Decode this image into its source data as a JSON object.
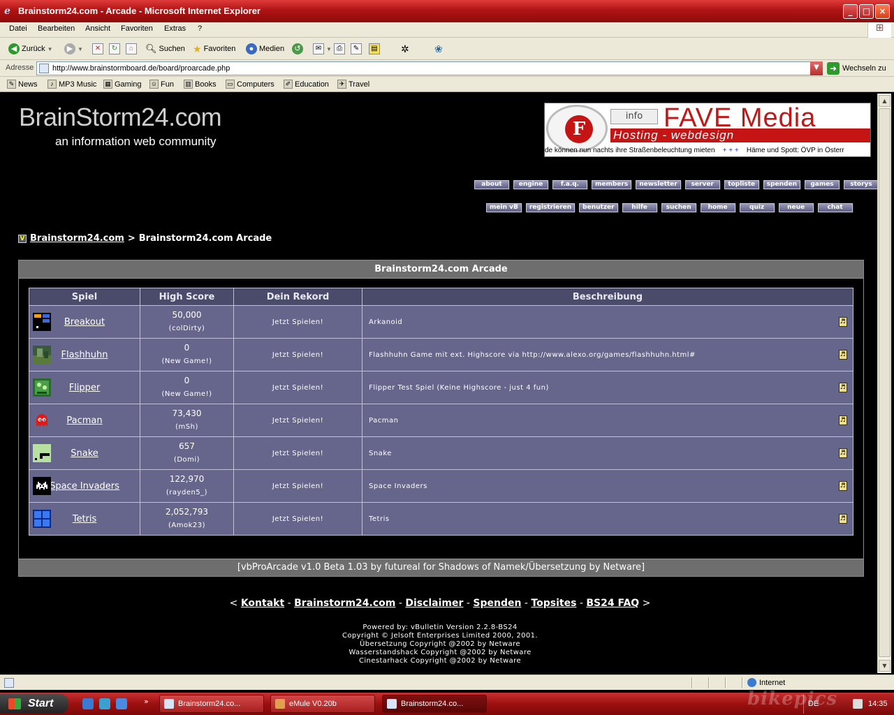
{
  "window": {
    "title": "Brainstorm24.com - Arcade - Microsoft Internet Explorer",
    "controls": [
      "_",
      "□",
      "×"
    ]
  },
  "menubar": [
    "Datei",
    "Bearbeiten",
    "Ansicht",
    "Favoriten",
    "Extras",
    "?"
  ],
  "toolbar": {
    "back": "Zurück",
    "search": "Suchen",
    "favorites": "Favoriten",
    "media": "Medien"
  },
  "address": {
    "label": "Adresse",
    "url": "http://www.brainstormboard.de/board/proarcade.php",
    "go": "Wechseln zu"
  },
  "links": [
    "News",
    "MP3 Music",
    "Gaming",
    "Fun",
    "Books",
    "Computers",
    "Education",
    "Travel"
  ],
  "site": {
    "title": "BrainStorm24.com",
    "subtitle": "an information web community"
  },
  "banner": {
    "info": "info",
    "brand": "FAVE Media",
    "tagline": "Hosting - webdesign",
    "ticker_a": "de können nun nachts ihre Straßenbeleuchtung mieten",
    "ticker_sep": "+ + +",
    "ticker_b": "Häme und Spott: ÖVP in  Österr"
  },
  "nav_row1": [
    "about",
    "engine",
    "f.a.q.",
    "members",
    "newsletter",
    "server",
    "topliste",
    "spenden",
    "games",
    "storys"
  ],
  "nav_row2": [
    "mein vB",
    "registrieren",
    "benutzer",
    "hilfe",
    "suchen",
    "home",
    "quiz",
    "neue",
    "chat"
  ],
  "breadcrumb": {
    "home": "Brainstorm24.com",
    "separator": ">",
    "current": "Brainstorm24.com Arcade"
  },
  "panel": {
    "title": "Brainstorm24.com Arcade",
    "footer": "[vbProArcade v1.0 Beta 1.03 by futureal for Shadows of Namek/Übersetzung by Netware]"
  },
  "table": {
    "headers": [
      "Spiel",
      "High Score",
      "Dein Rekord",
      "Beschreibung"
    ],
    "rows": [
      {
        "game": "Breakout",
        "score": "50,000",
        "holder": "(colDirty)",
        "record": "Jetzt Spielen!",
        "desc": "Arkanoid",
        "icon": "breakout-icon"
      },
      {
        "game": "Flashhuhn",
        "score": "0",
        "holder": "(New Game!)",
        "record": "Jetzt Spielen!",
        "desc": "Flashhuhn Game mit ext. Highscore via http://www.alexo.org/games/flashhuhn.html#",
        "icon": "flashhuhn-icon"
      },
      {
        "game": "Flipper",
        "score": "0",
        "holder": "(New Game!)",
        "record": "Jetzt Spielen!",
        "desc": "Flipper Test Spiel (Keine Highscore - just 4 fun)",
        "icon": "flipper-icon"
      },
      {
        "game": "Pacman",
        "score": "73,430",
        "holder": "(mSh)",
        "record": "Jetzt Spielen!",
        "desc": "Pacman",
        "icon": "pacman-ghost-icon"
      },
      {
        "game": "Snake",
        "score": "657",
        "holder": "(Domi)",
        "record": "Jetzt Spielen!",
        "desc": "Snake",
        "icon": "snake-icon"
      },
      {
        "game": "Space Invaders",
        "score": "122,970",
        "holder": "(rayden5_)",
        "record": "Jetzt Spielen!",
        "desc": "Space Invaders",
        "icon": "space-invader-icon"
      },
      {
        "game": "Tetris",
        "score": "2,052,793",
        "holder": "(Amok23)",
        "record": "Jetzt Spielen!",
        "desc": "Tetris",
        "icon": "tetris-icon"
      }
    ]
  },
  "footer_links": {
    "open": "<",
    "items": [
      "Kontakt",
      "Brainstorm24.com",
      "Disclaimer",
      "Spenden",
      "Topsites",
      "BS24 FAQ"
    ],
    "sep": "-",
    "close": ">"
  },
  "credits": [
    "Powered by: vBulletin Version 2.2.8-BS24",
    "Copyright © Jelsoft Enterprises Limited 2000, 2001.",
    "Übersetzung Copyright @2002 by Netware",
    "Wasserstandshack Copyright @2002 by Netware",
    "Cinestarhack Copyright @2002 by Netware"
  ],
  "status": {
    "zone": "Internet"
  },
  "taskbar": {
    "start": "Start",
    "tasks": [
      "Brainstorm24.co...",
      "eMule V0.20b",
      "Brainstorm24.co..."
    ],
    "lang": "DE",
    "clock": "14:35"
  },
  "watermark": "bikepics"
}
